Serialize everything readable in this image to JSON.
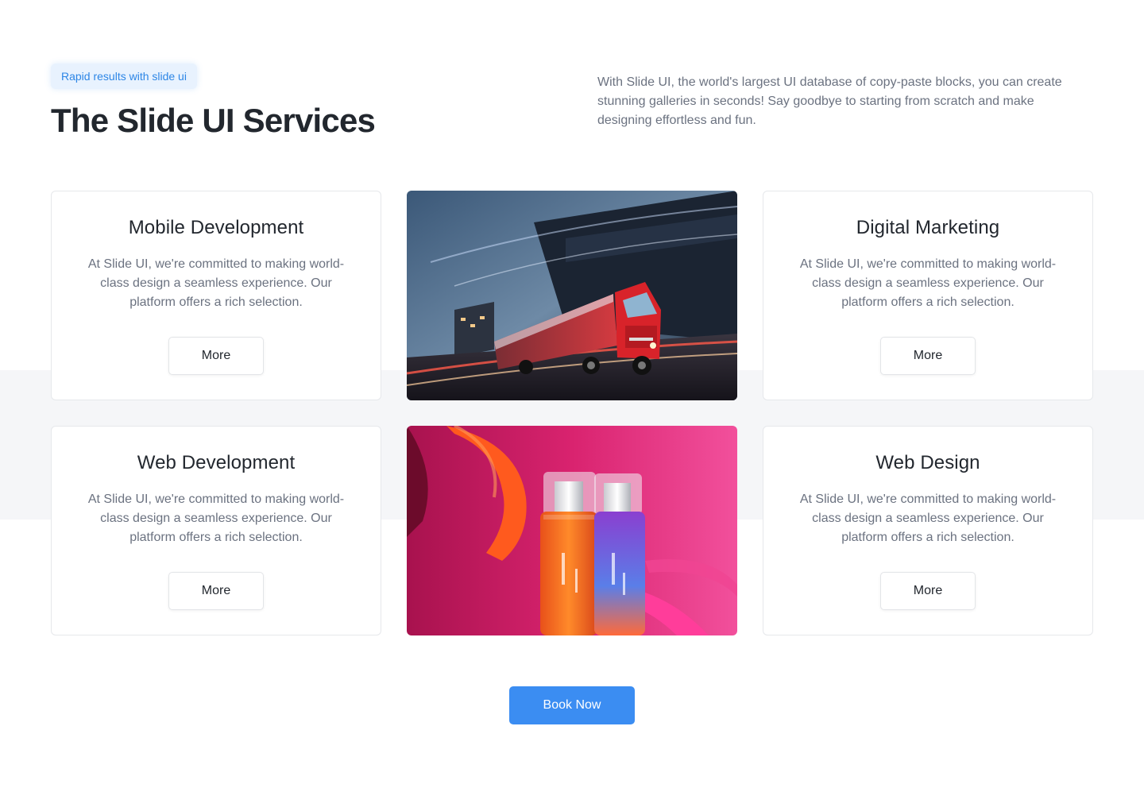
{
  "header": {
    "badge": "Rapid results with slide ui",
    "title": "The Slide UI Services",
    "intro": "With Slide UI, the world's largest UI database of copy-paste blocks, you can create stunning galleries in seconds! Say goodbye to starting from scratch and make designing effortless and fun."
  },
  "services": [
    {
      "title": "Mobile Development",
      "description": "At Slide UI, we're committed to making world-class design a seamless experience. Our platform offers a rich selection.",
      "button": "More"
    },
    {
      "title": "Digital Marketing",
      "description": "At Slide UI, we're committed to making world-class design a seamless experience. Our platform offers a rich selection.",
      "button": "More"
    },
    {
      "title": "Web Development",
      "description": "At Slide UI, we're committed to making world-class design a seamless experience. Our platform offers a rich selection.",
      "button": "More"
    },
    {
      "title": "Web Design",
      "description": "At Slide UI, we're committed to making world-class design a seamless experience. Our platform offers a rich selection.",
      "button": "More"
    }
  ],
  "images": {
    "top": "red-truck-photo",
    "bottom": "cosmetic-bottles-photo"
  },
  "cta": {
    "label": "Book Now"
  },
  "colors": {
    "accent": "#3b8df2",
    "badge_bg": "#e8f2fe",
    "badge_text": "#2d86e6",
    "band_bg": "#f5f6f8"
  }
}
